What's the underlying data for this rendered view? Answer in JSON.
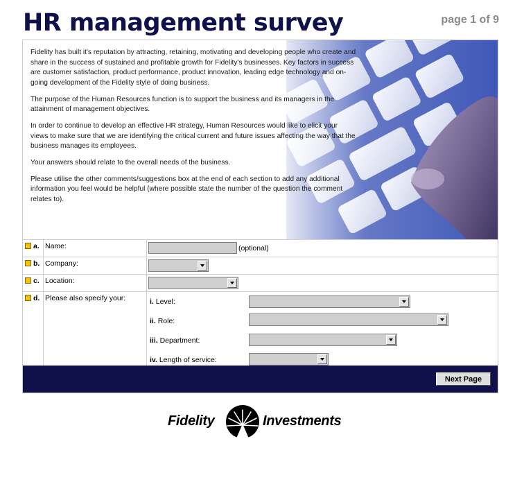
{
  "header": {
    "title": "HR management survey",
    "page_indicator": "page 1 of 9"
  },
  "intro": {
    "paragraphs": [
      "Fidelity has built it's reputation by attracting, retaining, motivating and developing people who create and share in the success of sustained and profitable growth for Fidelity's businesses. Key factors in success are customer satisfaction, product performance, product innovation, leading edge technology and on-going development of the Fidelity style of doing business.",
      "The purpose of the Human Resources function is to support the business and its managers in the attainment of management objectives.",
      "In order to continue to develop an effective HR strategy, Human Resources would like to elicit your views to make sure that we are identifying the critical current and future issues affecting the way that the business manages its employees.",
      "Your answers should relate to the overall needs of the business.",
      "Please utilise the other comments/suggestions box at the end of each section to add any additional information you feel would be helpful (where possible state the number of the question the comment relates to)."
    ]
  },
  "form": {
    "name": {
      "letter": "a.",
      "label": "Name:",
      "value": "",
      "note": "(optional)"
    },
    "company": {
      "letter": "b.",
      "label": "Company:",
      "value": ""
    },
    "location": {
      "letter": "c.",
      "label": "Location:",
      "value": ""
    },
    "specify": {
      "letter": "d.",
      "label": "Please also specify your:",
      "fields": [
        {
          "num": "i.",
          "label": "Level:",
          "value": ""
        },
        {
          "num": "ii.",
          "label": "Role:",
          "value": ""
        },
        {
          "num": "iii.",
          "label": "Department:",
          "value": ""
        },
        {
          "num": "iv.",
          "label": "Length of service:",
          "value": ""
        }
      ]
    }
  },
  "footer": {
    "next_label": "Next Page"
  },
  "logo": {
    "left_text": "Fidelity",
    "right_text": "Investments"
  },
  "colors": {
    "navy": "#10104a",
    "marker": "#f2c312",
    "field": "#cfcfcf",
    "page_indicator": "#8a8a8a"
  }
}
